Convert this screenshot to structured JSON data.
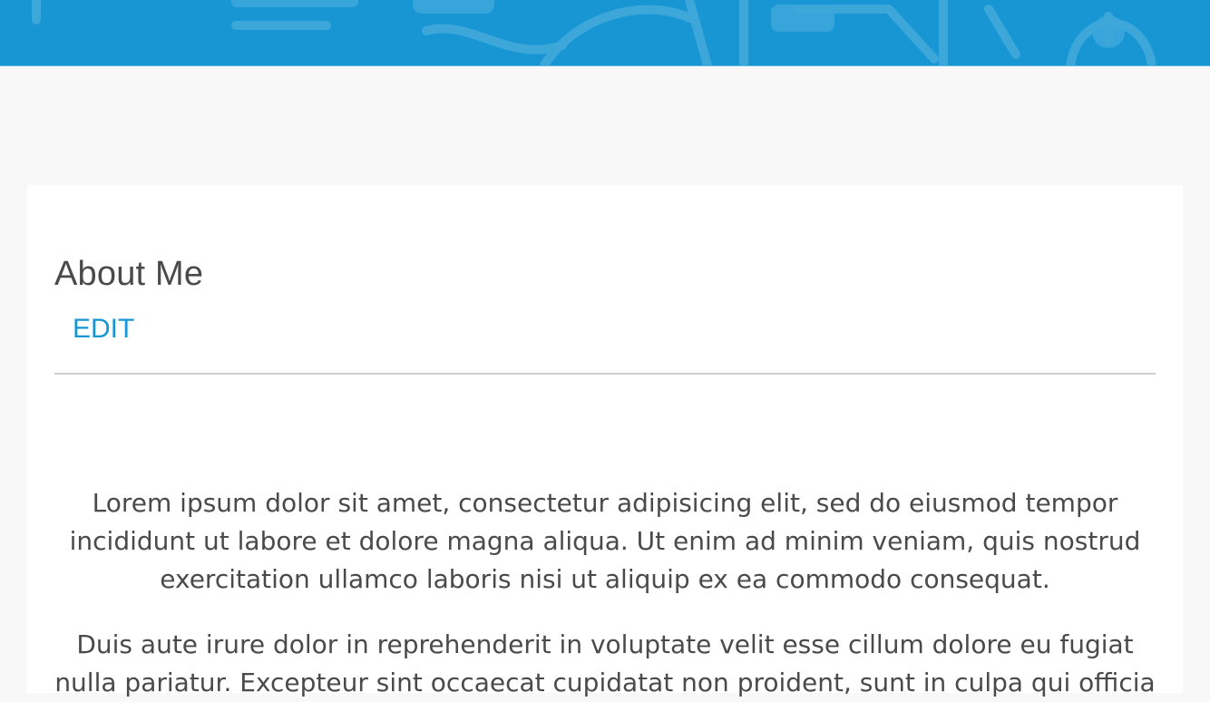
{
  "profile": {
    "heading": "About Me",
    "edit_label": "EDIT",
    "about_paragraphs": [
      "Lorem ipsum dolor sit amet, consectetur adipisicing elit, sed do eiusmod tempor incididunt ut labore et dolore magna aliqua. Ut enim ad minim veniam, quis nostrud exercitation ullamco laboris nisi ut aliquip ex ea commodo consequat.",
      "Duis aute irure dolor in reprehenderit in voluptate velit esse cillum dolore eu fugiat nulla pariatur. Excepteur sint occaecat cupidatat non proident, sunt in culpa qui officia"
    ]
  },
  "colors": {
    "accent": "#1796d3",
    "background": "#f8f8f8",
    "card": "#ffffff",
    "text": "#4a4a4a",
    "divider": "#cfcfcf"
  },
  "icons": {
    "topbar_decoration": "pattern-background-icon"
  }
}
